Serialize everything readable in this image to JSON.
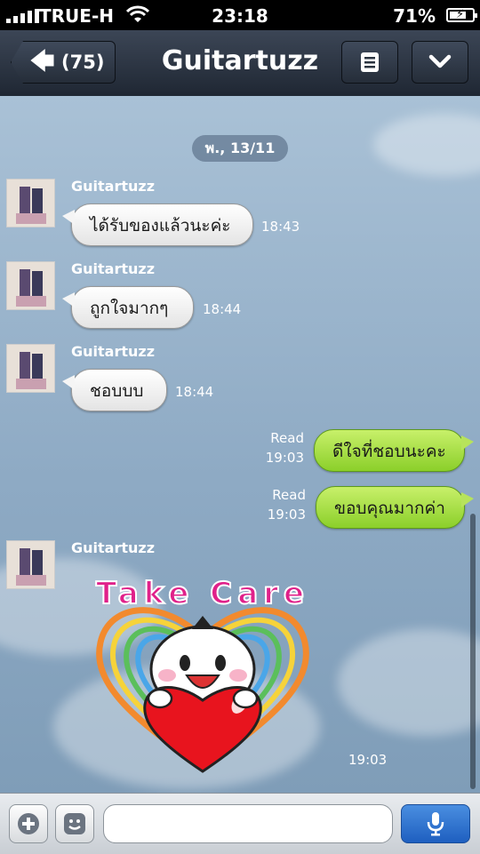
{
  "status_bar": {
    "carrier": "TRUE-H",
    "time": "23:18",
    "battery_percent": "71%"
  },
  "nav": {
    "back_count": "(75)",
    "title": "Guitartuzz",
    "menu_icon": "list-icon",
    "down_icon": "chevron-down-icon"
  },
  "chat": {
    "date_label": "พ., 13/11",
    "messages": [
      {
        "sender": "Guitartuzz",
        "text": "ได้รับของแล้วนะค่ะ",
        "time": "18:43"
      },
      {
        "sender": "Guitartuzz",
        "text": "ถูกใจมากๆ",
        "time": "18:44"
      },
      {
        "sender": "Guitartuzz",
        "text": "ชอบบบ",
        "time": "18:44"
      },
      {
        "read": "Read",
        "text": "ดีใจที่ชอบนะคะ",
        "time": "19:03"
      },
      {
        "read": "Read",
        "text": "ขอบคุณมากค่า",
        "time": "19:03"
      },
      {
        "sender": "Guitartuzz",
        "sticker_text": "Take Care",
        "time": "19:03"
      }
    ]
  },
  "input": {
    "placeholder": "",
    "add_icon": "plus-icon",
    "sticker_icon": "emoticon-icon",
    "mic_icon": "microphone-icon"
  },
  "colors": {
    "outgoing_bubble": "#a6e043",
    "incoming_bubble": "#ffffff",
    "nav_bg": "#2b3440",
    "mic_button": "#2f74d0"
  }
}
